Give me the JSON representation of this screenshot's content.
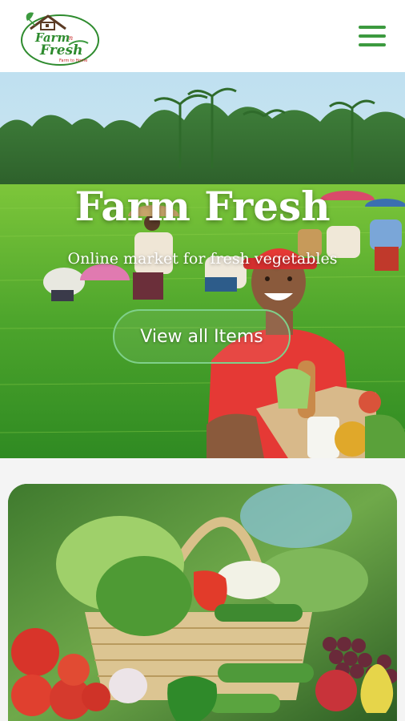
{
  "header": {
    "logo_line1": "Farm",
    "logo_line2": "Fresh",
    "logo_tagline": "Farm to Home",
    "menu_icon": "hamburger-menu-icon"
  },
  "hero": {
    "title": "Farm Fresh",
    "subtitle": "Online market for fresh vegetables",
    "cta_label": "View all Items"
  },
  "colors": {
    "brand_green": "#3c9a3f",
    "cta_border": "#7fd08a",
    "logo_green": "#2e8b2e",
    "logo_red": "#c62828"
  }
}
